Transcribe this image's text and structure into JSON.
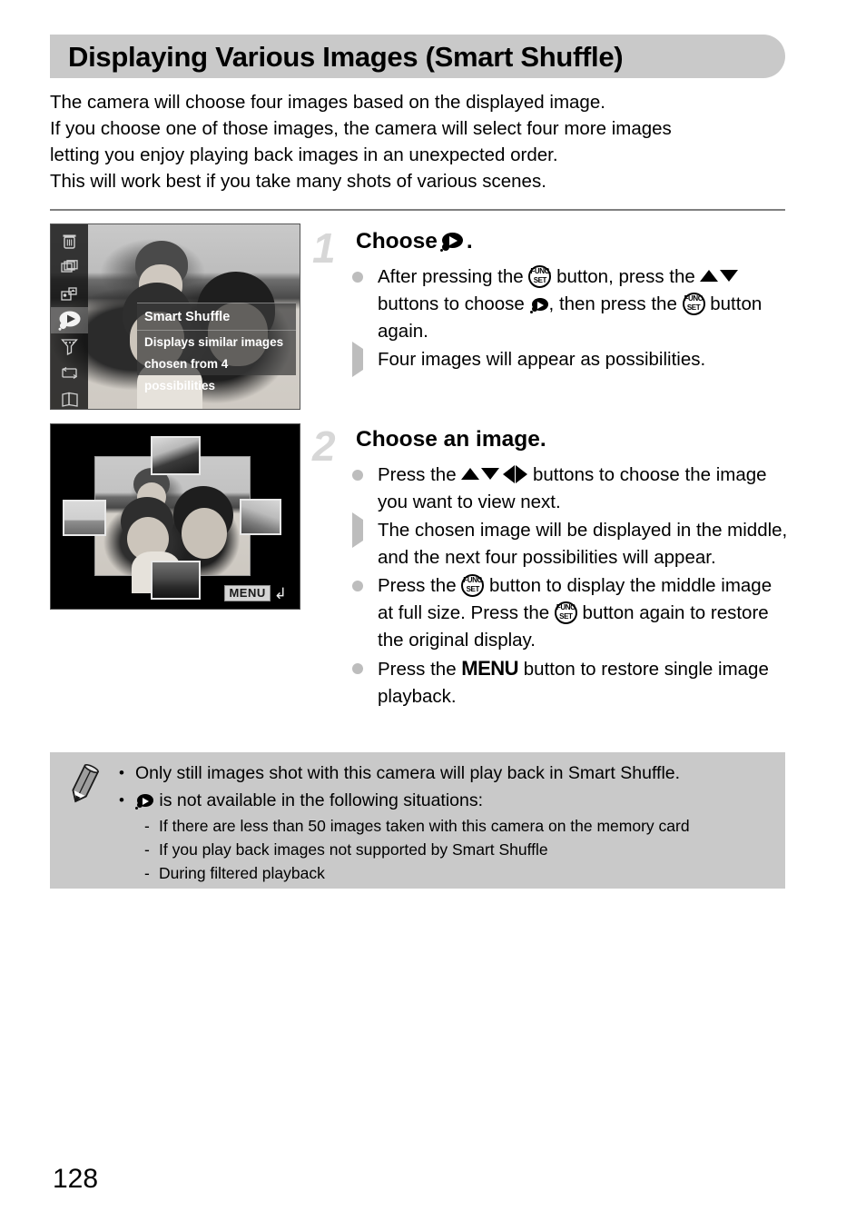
{
  "header": {
    "title": "Displaying Various Images (Smart Shuffle)"
  },
  "intro": {
    "lines": [
      "The camera will choose four images based on the displayed image.",
      "If you choose one of those images, the camera will select four more images",
      "letting you enjoy playing back images in an unexpected order.",
      "This will work best if you take many shots of various scenes."
    ]
  },
  "screenshots": {
    "func_menu": {
      "menu_title": "Smart Shuffle",
      "description_line1": "Displays similar images",
      "description_line2": "chosen from 4 possibilities",
      "sidebar_icons": [
        "trash-icon",
        "slideshow-icon",
        "group-images-icon",
        "smart-shuffle-icon",
        "filter-playback-icon",
        "rotate-icon",
        "photobook-icon"
      ],
      "selected_index": 3
    },
    "smart_shuffle_view": {
      "menu_label": "MENU",
      "return_glyph": "return-arrow-icon",
      "thumbnail_count": 4
    }
  },
  "steps": [
    {
      "number": "1",
      "heading_prefix": "Choose",
      "heading_suffix": ".",
      "heading_icon": "smart-shuffle-icon",
      "items": [
        {
          "marker": "dot",
          "segments": [
            {
              "type": "text",
              "value": "After pressing the "
            },
            {
              "type": "icon",
              "value": "func-set-button-icon"
            },
            {
              "type": "text",
              "value": " button, press the "
            },
            {
              "type": "icon",
              "value": "up-down-buttons-icon"
            },
            {
              "type": "text",
              "value": " buttons to choose "
            },
            {
              "type": "icon",
              "value": "smart-shuffle-icon"
            },
            {
              "type": "text",
              "value": ", then press the "
            },
            {
              "type": "icon",
              "value": "func-set-button-icon"
            },
            {
              "type": "text",
              "value": " button again."
            }
          ]
        },
        {
          "marker": "triangle",
          "segments": [
            {
              "type": "text",
              "value": "Four images will appear as possibilities."
            }
          ]
        }
      ]
    },
    {
      "number": "2",
      "heading_prefix": "Choose an image.",
      "heading_suffix": "",
      "heading_icon": "",
      "items": [
        {
          "marker": "dot",
          "segments": [
            {
              "type": "text",
              "value": "Press the "
            },
            {
              "type": "icon",
              "value": "four-way-buttons-icon"
            },
            {
              "type": "text",
              "value": " buttons to choose the image you want to view next."
            }
          ]
        },
        {
          "marker": "triangle",
          "segments": [
            {
              "type": "text",
              "value": "The chosen image will be displayed in the middle, and the next four possibilities will appear."
            }
          ]
        },
        {
          "marker": "dot",
          "segments": [
            {
              "type": "text",
              "value": "Press the "
            },
            {
              "type": "icon",
              "value": "func-set-button-icon"
            },
            {
              "type": "text",
              "value": " button to display the middle image at full size. Press the "
            },
            {
              "type": "icon",
              "value": "func-set-button-icon"
            },
            {
              "type": "text",
              "value": " button again to restore the original display."
            }
          ]
        },
        {
          "marker": "dot",
          "segments": [
            {
              "type": "text",
              "value": "Press the "
            },
            {
              "type": "icon",
              "value": "menu-button-icon"
            },
            {
              "type": "text",
              "value": " button to restore single image playback."
            }
          ]
        }
      ]
    }
  ],
  "notes": {
    "icon": "pencil-icon",
    "bullets": [
      {
        "segments": [
          {
            "type": "text",
            "value": "Only still images shot with this camera will play back in Smart Shuffle."
          }
        ],
        "subitems": []
      },
      {
        "segments": [
          {
            "type": "icon",
            "value": "smart-shuffle-icon"
          },
          {
            "type": "text",
            "value": " is not available in the following situations:"
          }
        ],
        "subitems": [
          "If there are less than 50 images taken with this camera on the memory card",
          "If you play back images not supported by Smart Shuffle",
          "During filtered playback"
        ]
      }
    ]
  },
  "footer": {
    "page_number": "128"
  },
  "colors": {
    "header_bg": "#c9c9c9",
    "notes_bg": "#c9c9c9",
    "rule": "#808080",
    "marker_gray": "#bdbdbd",
    "step_number": "#d7d7d7"
  }
}
